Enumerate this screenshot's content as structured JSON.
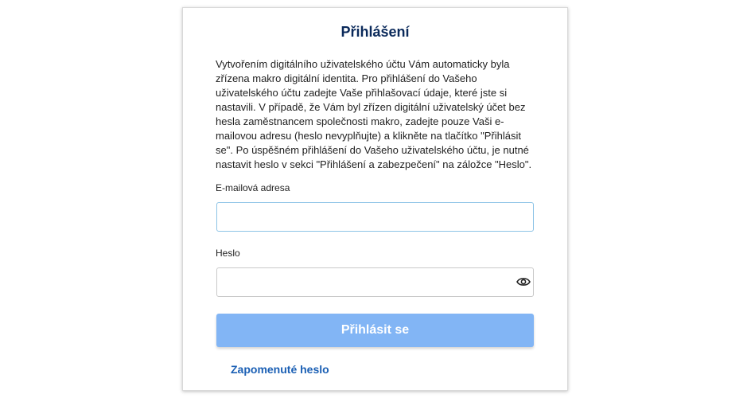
{
  "login": {
    "title": "Přihlášení",
    "intro": "Vytvořením digitálního uživatelského účtu Vám automaticky byla zřízena makro digitální identita. Pro přihlášení do Vašeho uživatelského účtu zadejte Vaše přihlašovací údaje, které jste si nastavili. V případě, že Vám byl zřízen digitální uživatelský účet bez hesla zaměstnancem společnosti makro, zadejte pouze Vaši e-mailovou adresu (heslo nevyplňujte) a klikněte na tlačítko \"Přihlásit se\". Po úspěšném přihlášení do Vašeho uživatelského účtu, je nutné nastavit heslo v sekci \"Přihlášení a zabezpečení\" na záložce \"Heslo\".",
    "email_label": "E-mailová adresa",
    "email_value": "",
    "password_label": "Heslo",
    "password_value": "",
    "password_toggle_icon": "eye-icon",
    "submit_label": "Přihlásit se",
    "forgot_link": "Zapomenuté heslo"
  },
  "colors": {
    "title": "#0b2a5b",
    "button_bg": "#82b5f5",
    "link": "#1a5fb4",
    "email_border_focus": "#8cc3e6"
  }
}
